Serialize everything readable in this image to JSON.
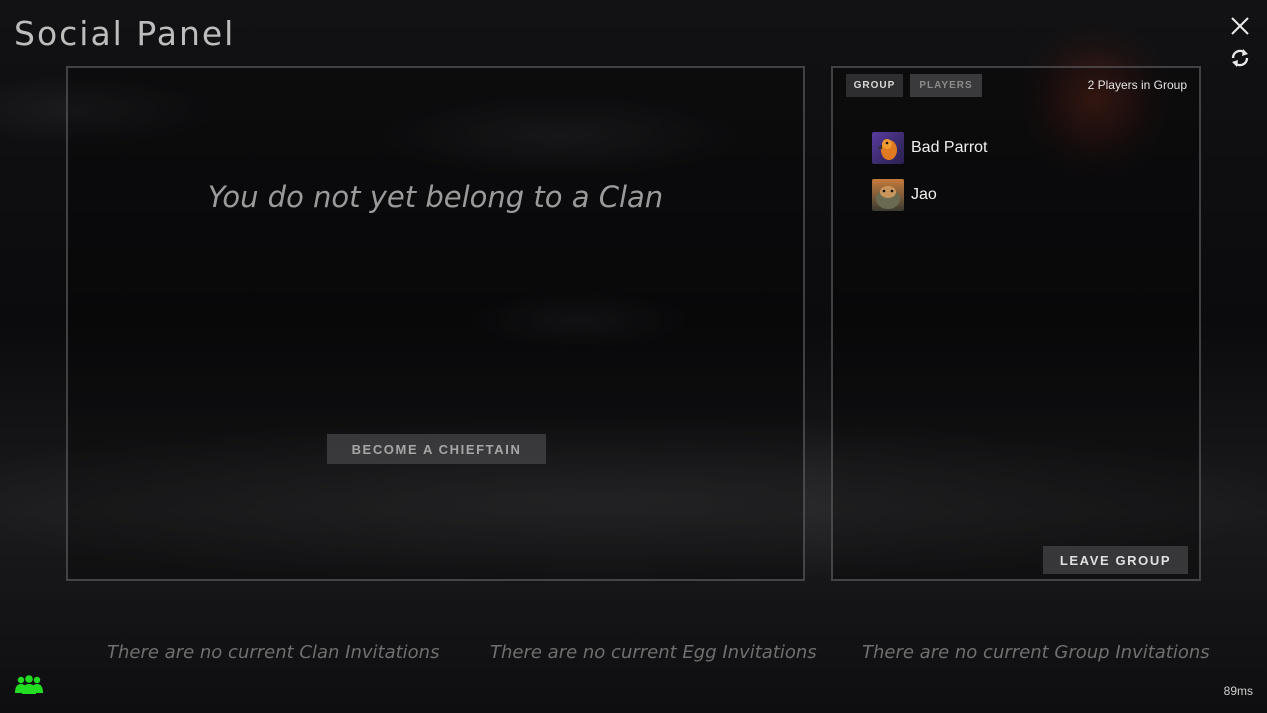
{
  "title": "Social Panel",
  "clan": {
    "message": "You do not yet belong to a Clan",
    "become_chieftain_label": "BECOME A CHIEFTAIN"
  },
  "group": {
    "tabs": [
      {
        "label": "GROUP",
        "active": true
      },
      {
        "label": "PLAYERS",
        "active": false
      }
    ],
    "count_label": "2 Players in Group",
    "members": [
      {
        "name": "Bad Parrot",
        "avatar": "parrot-avatar"
      },
      {
        "name": "Jao",
        "avatar": "jao-avatar"
      }
    ],
    "leave_label": "LEAVE GROUP"
  },
  "invitations": {
    "clan": "There are no current Clan Invitations",
    "egg": "There are no current Egg Invitations",
    "group": "There are no current Group Invitations"
  },
  "footer": {
    "ping": "89ms",
    "social_icon_color": "#22dd22"
  },
  "icons": {
    "close": "close-icon",
    "refresh": "refresh-icon",
    "social": "group-people-icon"
  }
}
